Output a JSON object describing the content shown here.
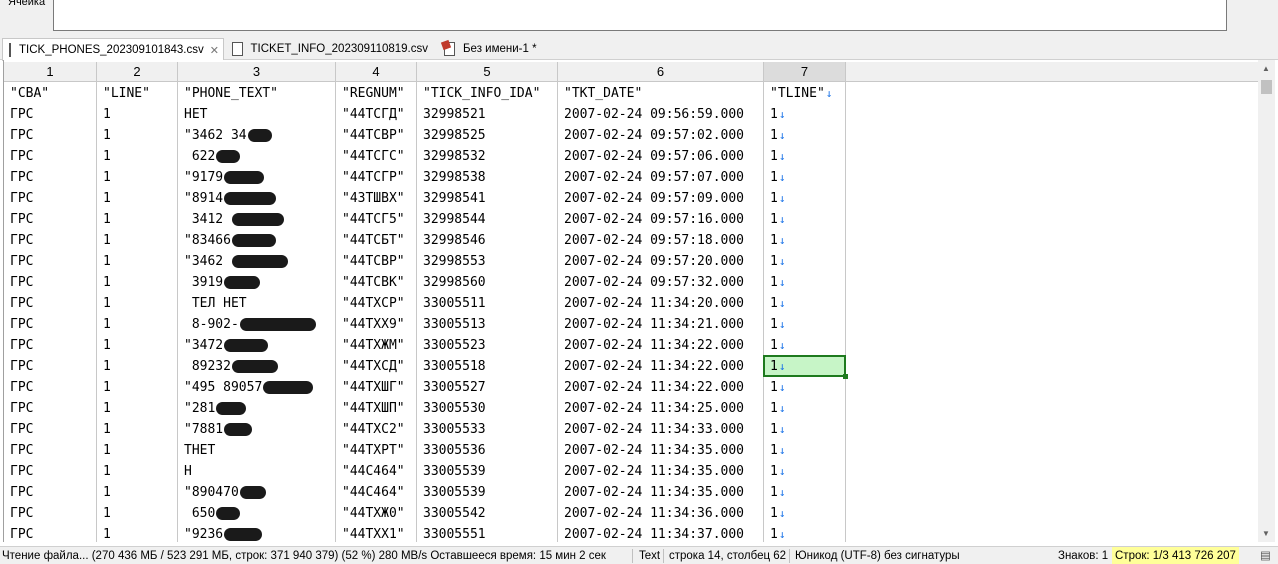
{
  "cell_input": {
    "label": "Ячейка",
    "value": ""
  },
  "tabs": [
    {
      "label": "TICK_PHONES_202309101843.csv",
      "active": true,
      "icon": "document-icon",
      "closable": true
    },
    {
      "label": "TICKET_INFO_202309110819.csv",
      "active": false,
      "icon": "document-icon",
      "closable": false
    },
    {
      "label": "Без имени-1 *",
      "active": false,
      "icon": "spreadsheet-icon",
      "closable": false
    }
  ],
  "columns": [
    "1",
    "2",
    "3",
    "4",
    "5",
    "6",
    "7"
  ],
  "active_column": "7",
  "rows": [
    [
      "\"CBA\"",
      "\"LINE\"",
      "\"PHONE_TEXT\"",
      "\"REGNUM\"",
      "\"TICK_INFO_IDA\"",
      "\"TKT_DATE\"",
      "\"TLINE\""
    ],
    [
      "ГРС",
      "1",
      "НЕТ",
      "\"44ТСГД\"",
      "32998521",
      "2007-02-24 09:56:59.000",
      "1"
    ],
    [
      "ГРС",
      "1",
      "\"3462 34",
      "\"44ТСВР\"",
      "32998525",
      "2007-02-24 09:57:02.000",
      "1"
    ],
    [
      "ГРС",
      "1",
      " 622",
      "\"44ТСГС\"",
      "32998532",
      "2007-02-24 09:57:06.000",
      "1"
    ],
    [
      "ГРС",
      "1",
      "\"9179",
      "\"44ТСГР\"",
      "32998538",
      "2007-02-24 09:57:07.000",
      "1"
    ],
    [
      "ГРС",
      "1",
      "\"8914",
      "\"43ТШВХ\"",
      "32998541",
      "2007-02-24 09:57:09.000",
      "1"
    ],
    [
      "ГРС",
      "1",
      " 3412 ",
      "\"44ТСГ5\"",
      "32998544",
      "2007-02-24 09:57:16.000",
      "1"
    ],
    [
      "ГРС",
      "1",
      "\"83466",
      "\"44ТСБТ\"",
      "32998546",
      "2007-02-24 09:57:18.000",
      "1"
    ],
    [
      "ГРС",
      "1",
      "\"3462 ",
      "\"44ТСВР\"",
      "32998553",
      "2007-02-24 09:57:20.000",
      "1"
    ],
    [
      "ГРС",
      "1",
      " 3919",
      "\"44ТСВК\"",
      "32998560",
      "2007-02-24 09:57:32.000",
      "1"
    ],
    [
      "ГРС",
      "1",
      " ТЕЛ НЕТ",
      "\"44ТХСР\"",
      "33005511",
      "2007-02-24 11:34:20.000",
      "1"
    ],
    [
      "ГРС",
      "1",
      " 8-902-",
      "\"44ТХХ9\"",
      "33005513",
      "2007-02-24 11:34:21.000",
      "1"
    ],
    [
      "ГРС",
      "1",
      "\"3472",
      "\"44ТХЖМ\"",
      "33005523",
      "2007-02-24 11:34:22.000",
      "1"
    ],
    [
      "ГРС",
      "1",
      " 89232",
      "\"44ТХСД\"",
      "33005518",
      "2007-02-24 11:34:22.000",
      "1"
    ],
    [
      "ГРС",
      "1",
      "\"495 89057",
      "\"44ТХШГ\"",
      "33005527",
      "2007-02-24 11:34:22.000",
      "1"
    ],
    [
      "ГРС",
      "1",
      "\"281",
      "\"44ТХШП\"",
      "33005530",
      "2007-02-24 11:34:25.000",
      "1"
    ],
    [
      "ГРС",
      "1",
      "\"7881",
      "\"44ТХС2\"",
      "33005533",
      "2007-02-24 11:34:33.000",
      "1"
    ],
    [
      "ГРС",
      "1",
      "ТНЕТ",
      "\"44ТХРТ\"",
      "33005536",
      "2007-02-24 11:34:35.000",
      "1"
    ],
    [
      "ГРС",
      "1",
      "Н",
      "\"44С464\"",
      "33005539",
      "2007-02-24 11:34:35.000",
      "1"
    ],
    [
      "ГРС",
      "1",
      "\"890470",
      "\"44С464\"",
      "33005539",
      "2007-02-24 11:34:35.000",
      "1"
    ],
    [
      "ГРС",
      "1",
      " 650",
      "\"44ТХЖ0\"",
      "33005542",
      "2007-02-24 11:34:36.000",
      "1"
    ],
    [
      "ГРС",
      "1",
      "\"9236",
      "\"44ТХХ1\"",
      "33005551",
      "2007-02-24 11:34:37.000",
      "1"
    ]
  ],
  "selected_row_index": 13,
  "selected_column": "7",
  "status": {
    "progress_text": "Чтение файла... (270 436 МБ / 523 291 МБ, строк: 371 940 379) (52 %) 280 MB/s Оставшееся время: 15 мин 2 сек",
    "mode": "Text",
    "position": "строка 14, столбец 62",
    "encoding": "Юникод (UTF-8) без сигнатуры",
    "chars": "Знаков: 1",
    "rows": "Строк: 1/3 413 726 207"
  },
  "colors": {
    "selection_fill": "#c7f5c7",
    "selection_border": "#1e7a1e",
    "line_feed_arrow": "#1a73e8",
    "status_highlight": "#ffff99"
  }
}
